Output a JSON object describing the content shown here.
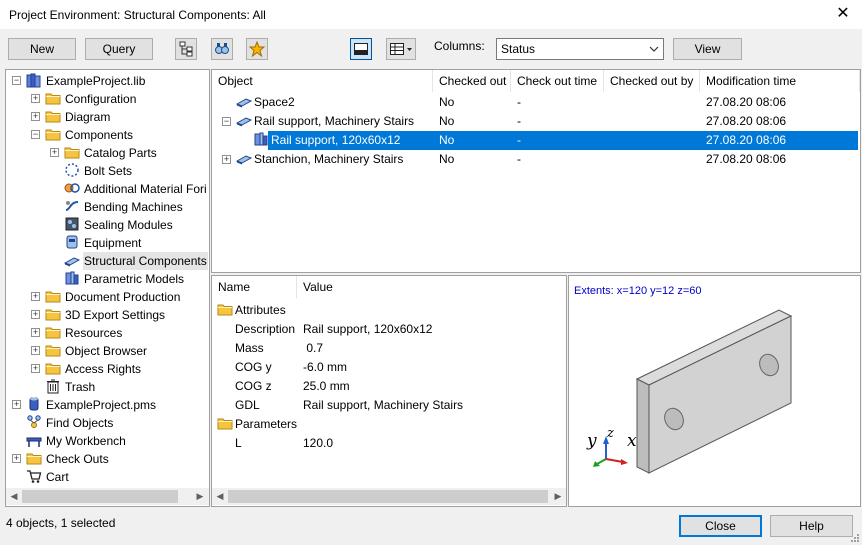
{
  "window": {
    "title": "Project Environment: Structural Components: All",
    "close_glyph": "✕"
  },
  "toolbar": {
    "new_label": "New",
    "query_label": "Query",
    "columns_label": "Columns:",
    "columns_value": "Status",
    "view_label": "View"
  },
  "tree": {
    "items": [
      {
        "label": "ExampleProject.lib",
        "icon": "library-icon",
        "depth": 0,
        "expander": "−"
      },
      {
        "label": "Configuration",
        "icon": "folder-icon",
        "depth": 1,
        "expander": "+"
      },
      {
        "label": "Diagram",
        "icon": "folder-icon",
        "depth": 1,
        "expander": "+"
      },
      {
        "label": "Components",
        "icon": "folder-icon",
        "depth": 1,
        "expander": "−"
      },
      {
        "label": "Catalog Parts",
        "icon": "folder-icon",
        "depth": 2,
        "expander": "+"
      },
      {
        "label": "Bolt Sets",
        "icon": "bolt-set-icon",
        "depth": 2,
        "expander": ""
      },
      {
        "label": "Additional Material Fori",
        "icon": "material-icon",
        "depth": 2,
        "expander": ""
      },
      {
        "label": "Bending Machines",
        "icon": "bending-machine-icon",
        "depth": 2,
        "expander": ""
      },
      {
        "label": "Sealing Modules",
        "icon": "sealing-module-icon",
        "depth": 2,
        "expander": ""
      },
      {
        "label": "Equipment",
        "icon": "equipment-icon",
        "depth": 2,
        "expander": ""
      },
      {
        "label": "Structural Components",
        "icon": "structural-component-icon",
        "depth": 2,
        "expander": "",
        "selected": true
      },
      {
        "label": "Parametric Models",
        "icon": "parametric-model-icon",
        "depth": 2,
        "expander": ""
      },
      {
        "label": "Document Production",
        "icon": "folder-icon",
        "depth": 1,
        "expander": "+"
      },
      {
        "label": "3D Export Settings",
        "icon": "folder-icon",
        "depth": 1,
        "expander": "+"
      },
      {
        "label": "Resources",
        "icon": "folder-icon",
        "depth": 1,
        "expander": "+"
      },
      {
        "label": "Object Browser",
        "icon": "folder-icon",
        "depth": 1,
        "expander": "+"
      },
      {
        "label": "Access Rights",
        "icon": "folder-icon",
        "depth": 1,
        "expander": "+"
      },
      {
        "label": "Trash",
        "icon": "trash-icon",
        "depth": 1,
        "expander": ""
      },
      {
        "label": "ExampleProject.pms",
        "icon": "database-icon",
        "depth": 0,
        "expander": "+"
      },
      {
        "label": "Find Objects",
        "icon": "find-objects-icon",
        "depth": 0,
        "expander": ""
      },
      {
        "label": "My Workbench",
        "icon": "workbench-icon",
        "depth": 0,
        "expander": ""
      },
      {
        "label": "Check Outs",
        "icon": "folder-icon",
        "depth": 0,
        "expander": "+"
      },
      {
        "label": "Cart",
        "icon": "cart-icon",
        "depth": 0,
        "expander": ""
      }
    ]
  },
  "grid": {
    "columns": [
      "Object",
      "Checked out",
      "Check out time",
      "Checked out by",
      "Modification time"
    ],
    "rows": [
      {
        "object": "Space2",
        "checked_out": "No",
        "check_out_time": "-",
        "checked_out_by": "",
        "modification_time": "27.08.20  08:06",
        "depth": 0,
        "expander": "",
        "icon": "plate-icon"
      },
      {
        "object": "Rail support, Machinery Stairs",
        "checked_out": "No",
        "check_out_time": "-",
        "checked_out_by": "",
        "modification_time": "27.08.20  08:06",
        "depth": 0,
        "expander": "−",
        "icon": "plate-icon"
      },
      {
        "object": "Rail support, 120x60x12",
        "checked_out": "No",
        "check_out_time": "-",
        "checked_out_by": "",
        "modification_time": "27.08.20  08:06",
        "depth": 1,
        "expander": "",
        "icon": "parametric-model-icon",
        "selected": true
      },
      {
        "object": "Stanchion, Machinery Stairs",
        "checked_out": "No",
        "check_out_time": "-",
        "checked_out_by": "",
        "modification_time": "27.08.20  08:06",
        "depth": 0,
        "expander": "+",
        "icon": "plate-icon"
      }
    ]
  },
  "properties": {
    "columns": [
      "Name",
      "Value"
    ],
    "attributes_label": "Attributes",
    "attributes": [
      {
        "name": "Description",
        "value": "Rail support, 120x60x12"
      },
      {
        "name": "Mass",
        "value": " 0.7"
      },
      {
        "name": "COG y",
        "value": "-6.0 mm"
      },
      {
        "name": "COG z",
        "value": "25.0 mm"
      },
      {
        "name": "GDL",
        "value": "Rail support, Machinery Stairs"
      }
    ],
    "parameters_label": "Parameters",
    "parameters": [
      {
        "name": "L",
        "value": "120.0"
      }
    ]
  },
  "preview": {
    "extents": "Extents: x=120 y=12 z=60",
    "axis_y": "y",
    "axis_z": "z",
    "axis_x": "x",
    "extents_color": "#0000cc"
  },
  "status": {
    "text": "4 objects, 1 selected",
    "close_label": "Close",
    "help_label": "Help"
  },
  "colors": {
    "selection": "#0078d7",
    "folder": "#f5c542"
  }
}
